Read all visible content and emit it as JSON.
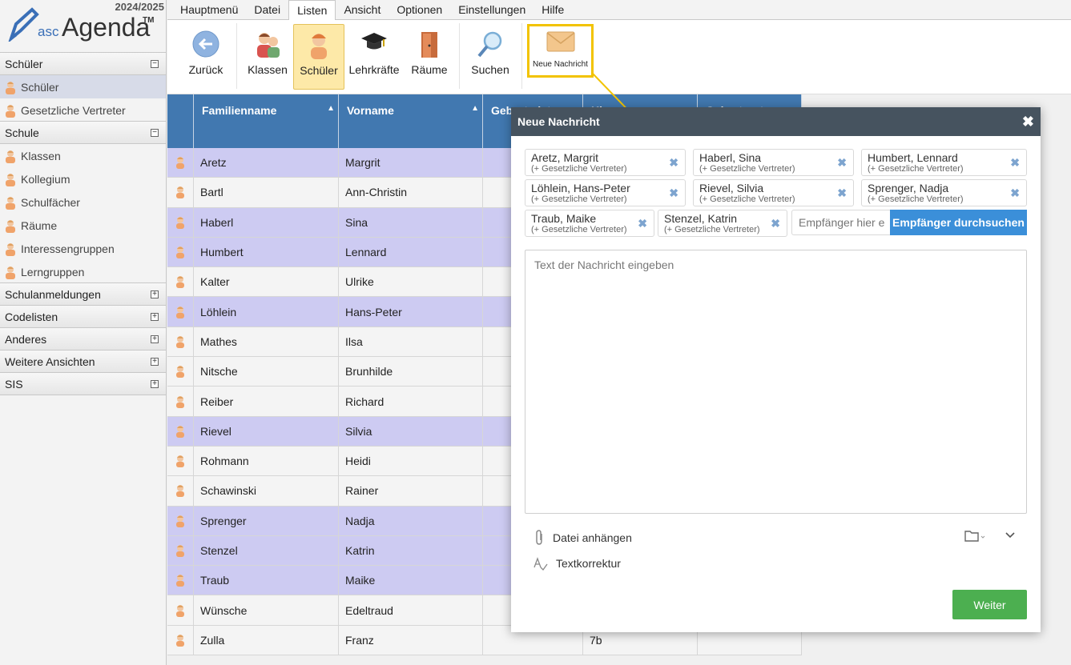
{
  "app": {
    "year": "2024/2025",
    "logo_asc": "asc",
    "logo_agenda": "Agenda",
    "logo_tm": "TM"
  },
  "sidebar": {
    "sections": [
      {
        "label": "Schüler",
        "toggle": "−",
        "items": [
          {
            "label": "Schüler",
            "active": true,
            "icon": "student-icon"
          },
          {
            "label": "Gesetzliche Vertreter",
            "icon": "parents-icon"
          }
        ]
      },
      {
        "label": "Schule",
        "toggle": "−",
        "items": [
          {
            "label": "Klassen",
            "icon": "class-icon"
          },
          {
            "label": "Kollegium",
            "icon": "graduation-cap-icon"
          },
          {
            "label": "Schulfächer",
            "icon": "subject-icon"
          },
          {
            "label": "Räume",
            "icon": "door-icon"
          },
          {
            "label": "Interessengruppen",
            "icon": "interest-group-icon"
          },
          {
            "label": "Lerngruppen",
            "icon": "learning-group-icon"
          }
        ]
      },
      {
        "label": "Schulanmeldungen",
        "toggle": "+",
        "items": []
      },
      {
        "label": "Codelisten",
        "toggle": "+",
        "items": []
      },
      {
        "label": "Anderes",
        "toggle": "+",
        "items": []
      },
      {
        "label": "Weitere Ansichten",
        "toggle": "+",
        "items": []
      },
      {
        "label": "SIS",
        "toggle": "+",
        "items": []
      }
    ]
  },
  "menu": {
    "tabs": [
      "Hauptmenü",
      "Datei",
      "Listen",
      "Ansicht",
      "Optionen",
      "Einstellungen",
      "Hilfe"
    ],
    "active": "Listen"
  },
  "toolbar": {
    "back": "Zurück",
    "classes": "Klassen",
    "students": "Schüler",
    "teachers": "Lehrkräfte",
    "rooms": "Räume",
    "search": "Suchen",
    "new_message": "Neue Nachricht"
  },
  "grid": {
    "headers": [
      "Familienname",
      "Vorname",
      "Geburtsdat...",
      "Kl...",
      "Geburtsort..."
    ],
    "rows": [
      {
        "last": "Aretz",
        "first": "Margrit",
        "sel": true,
        "klasse": ""
      },
      {
        "last": "Bartl",
        "first": "Ann-Christin",
        "sel": false,
        "klasse": ""
      },
      {
        "last": "Haberl",
        "first": "Sina",
        "sel": true,
        "klasse": ""
      },
      {
        "last": "Humbert",
        "first": "Lennard",
        "sel": true,
        "klasse": ""
      },
      {
        "last": "Kalter",
        "first": "Ulrike",
        "sel": false,
        "klasse": ""
      },
      {
        "last": "Löhlein",
        "first": "Hans-Peter",
        "sel": true,
        "klasse": ""
      },
      {
        "last": "Mathes",
        "first": "Ilsa",
        "sel": false,
        "klasse": ""
      },
      {
        "last": "Nitsche",
        "first": "Brunhilde",
        "sel": false,
        "klasse": ""
      },
      {
        "last": "Reiber",
        "first": "Richard",
        "sel": false,
        "klasse": ""
      },
      {
        "last": "Rievel",
        "first": "Silvia",
        "sel": true,
        "klasse": ""
      },
      {
        "last": "Rohmann",
        "first": "Heidi",
        "sel": false,
        "klasse": ""
      },
      {
        "last": "Schawinski",
        "first": "Rainer",
        "sel": false,
        "klasse": ""
      },
      {
        "last": "Sprenger",
        "first": "Nadja",
        "sel": true,
        "klasse": ""
      },
      {
        "last": "Stenzel",
        "first": "Katrin",
        "sel": true,
        "klasse": ""
      },
      {
        "last": "Traub",
        "first": "Maike",
        "sel": true,
        "klasse": ""
      },
      {
        "last": "Wünsche",
        "first": "Edeltraud",
        "sel": false,
        "klasse": ""
      },
      {
        "last": "Zulla",
        "first": "Franz",
        "sel": false,
        "klasse": "7b"
      }
    ]
  },
  "dialog": {
    "title": "Neue Nachricht",
    "close": "✖",
    "recipients": [
      {
        "name": "Aretz, Margrit",
        "sub": "(+ Gesetzliche Vertreter)"
      },
      {
        "name": "Haberl, Sina",
        "sub": "(+ Gesetzliche Vertreter)"
      },
      {
        "name": "Humbert, Lennard",
        "sub": "(+ Gesetzliche Vertreter)"
      },
      {
        "name": "Löhlein, Hans-Peter",
        "sub": "(+ Gesetzliche Vertreter)"
      },
      {
        "name": "Rievel, Silvia",
        "sub": "(+ Gesetzliche Vertreter)"
      },
      {
        "name": "Sprenger, Nadja",
        "sub": "(+ Gesetzliche Vertreter)"
      },
      {
        "name": "Traub, Maike",
        "sub": "(+ Gesetzliche Vertreter)"
      },
      {
        "name": "Stenzel, Katrin",
        "sub": "(+ Gesetzliche Vertreter)"
      }
    ],
    "recipient_placeholder": "Empfänger hier ein",
    "search_button": "Empfänger durchsuchen",
    "message_placeholder": "Text der Nachricht eingeben",
    "attach": "Datei anhängen",
    "spellcheck": "Textkorrektur",
    "next": "Weiter"
  },
  "colors": {
    "header_blue": "#4178b0",
    "selected_row": "#cdcbf2",
    "dialog_title": "#46535f",
    "primary": "#3b8fd9",
    "success": "#4caf50",
    "highlight": "#f2c300"
  }
}
